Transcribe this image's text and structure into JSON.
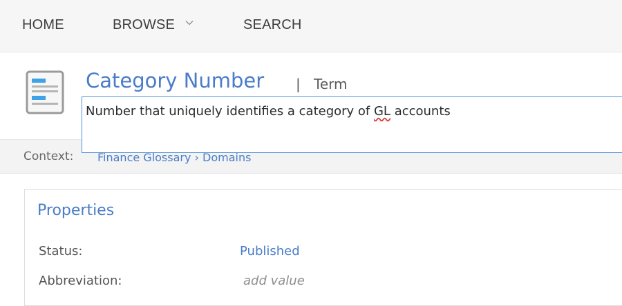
{
  "nav": {
    "home": "HOME",
    "browse": "BROWSE",
    "search": "SEARCH"
  },
  "asset": {
    "title": "Category Number",
    "separator": "|",
    "kind": "Term",
    "description_before": "Number that uniquely identifies a category of ",
    "description_flagged": "GL",
    "description_after": " accounts"
  },
  "context": {
    "label": "Context:",
    "path": "Finance Glossary › Domains"
  },
  "properties": {
    "heading": "Properties",
    "rows": [
      {
        "label": "Status:",
        "value": "Published"
      },
      {
        "label": "Abbreviation:",
        "value": "add value"
      }
    ]
  },
  "colors": {
    "accent": "#4a7cc9",
    "icon_blue": "#3ea3e6",
    "edit_border": "#4d8fd6"
  },
  "icons": [
    "chevron-down-icon",
    "term-document-icon"
  ]
}
